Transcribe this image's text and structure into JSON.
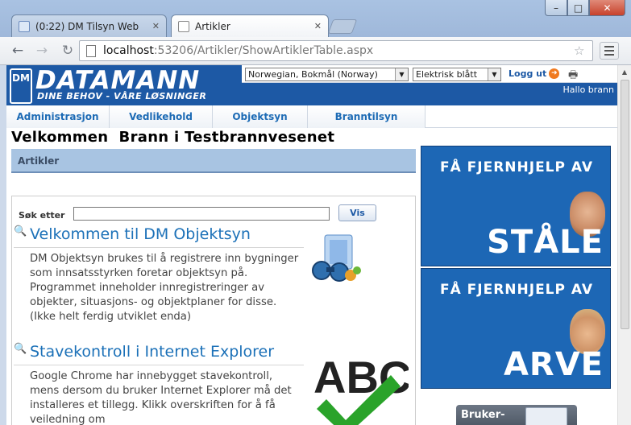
{
  "browser": {
    "tabs": [
      {
        "label": "(0:22) DM Tilsyn Web",
        "active": false
      },
      {
        "label": "Artikler",
        "active": true
      }
    ],
    "url_host": "localhost",
    "url_path": ":53206/Artikler/ShowArtiklerTable.aspx",
    "window_controls": {
      "minimize": "–",
      "maximize": "□",
      "close": "✕"
    }
  },
  "header": {
    "logo_badge": "DM",
    "logo_name": "DATAMANN",
    "logo_tagline": "DINE BEHOV - VÅRE LØSNINGER",
    "language_select": "Norwegian, Bokmål (Norway)",
    "theme_select": "Elektrisk blått",
    "logout_label": "Logg ut",
    "greeting": "Hallo brann"
  },
  "nav": {
    "items": [
      "Administrasjon",
      "Vedlikehold",
      "Objektsyn",
      "Branntilsyn"
    ]
  },
  "page": {
    "title": "Velkommen  Brann i Testbrannvesenet",
    "section_header": "Artikler",
    "search_label": "Søk etter",
    "search_value": "",
    "search_button": "Vis"
  },
  "articles": [
    {
      "title": "Velkommen til DM Objektsyn",
      "body": "DM Objektsyn brukes til å registrere inn bygninger som innsatsstyrken foretar objektsyn på. Programmet inneholder innregistreringer av objekter, situasjons- og objektplaner for disse. (Ikke helt ferdig utviklet enda)",
      "icon": "binoculars-icon"
    },
    {
      "title": "Stavekontroll i Internet Explorer",
      "body": "Google Chrome har innebygget stavekontroll, mens dersom du bruker Internet Explorer må det installeres et tillegg. Klikk overskriften for å få veiledning om",
      "icon": "abc-checkmark-icon"
    }
  ],
  "ads": [
    {
      "top": "FÅ FJERNHJELP AV",
      "name": "STÅLE"
    },
    {
      "top": "FÅ FJERNHJELP AV",
      "name": "ARVE"
    }
  ],
  "manual_button": "Bruker-",
  "colors": {
    "brand": "#1d59a5",
    "link": "#1c71b8",
    "section": "#a8c4e2"
  }
}
